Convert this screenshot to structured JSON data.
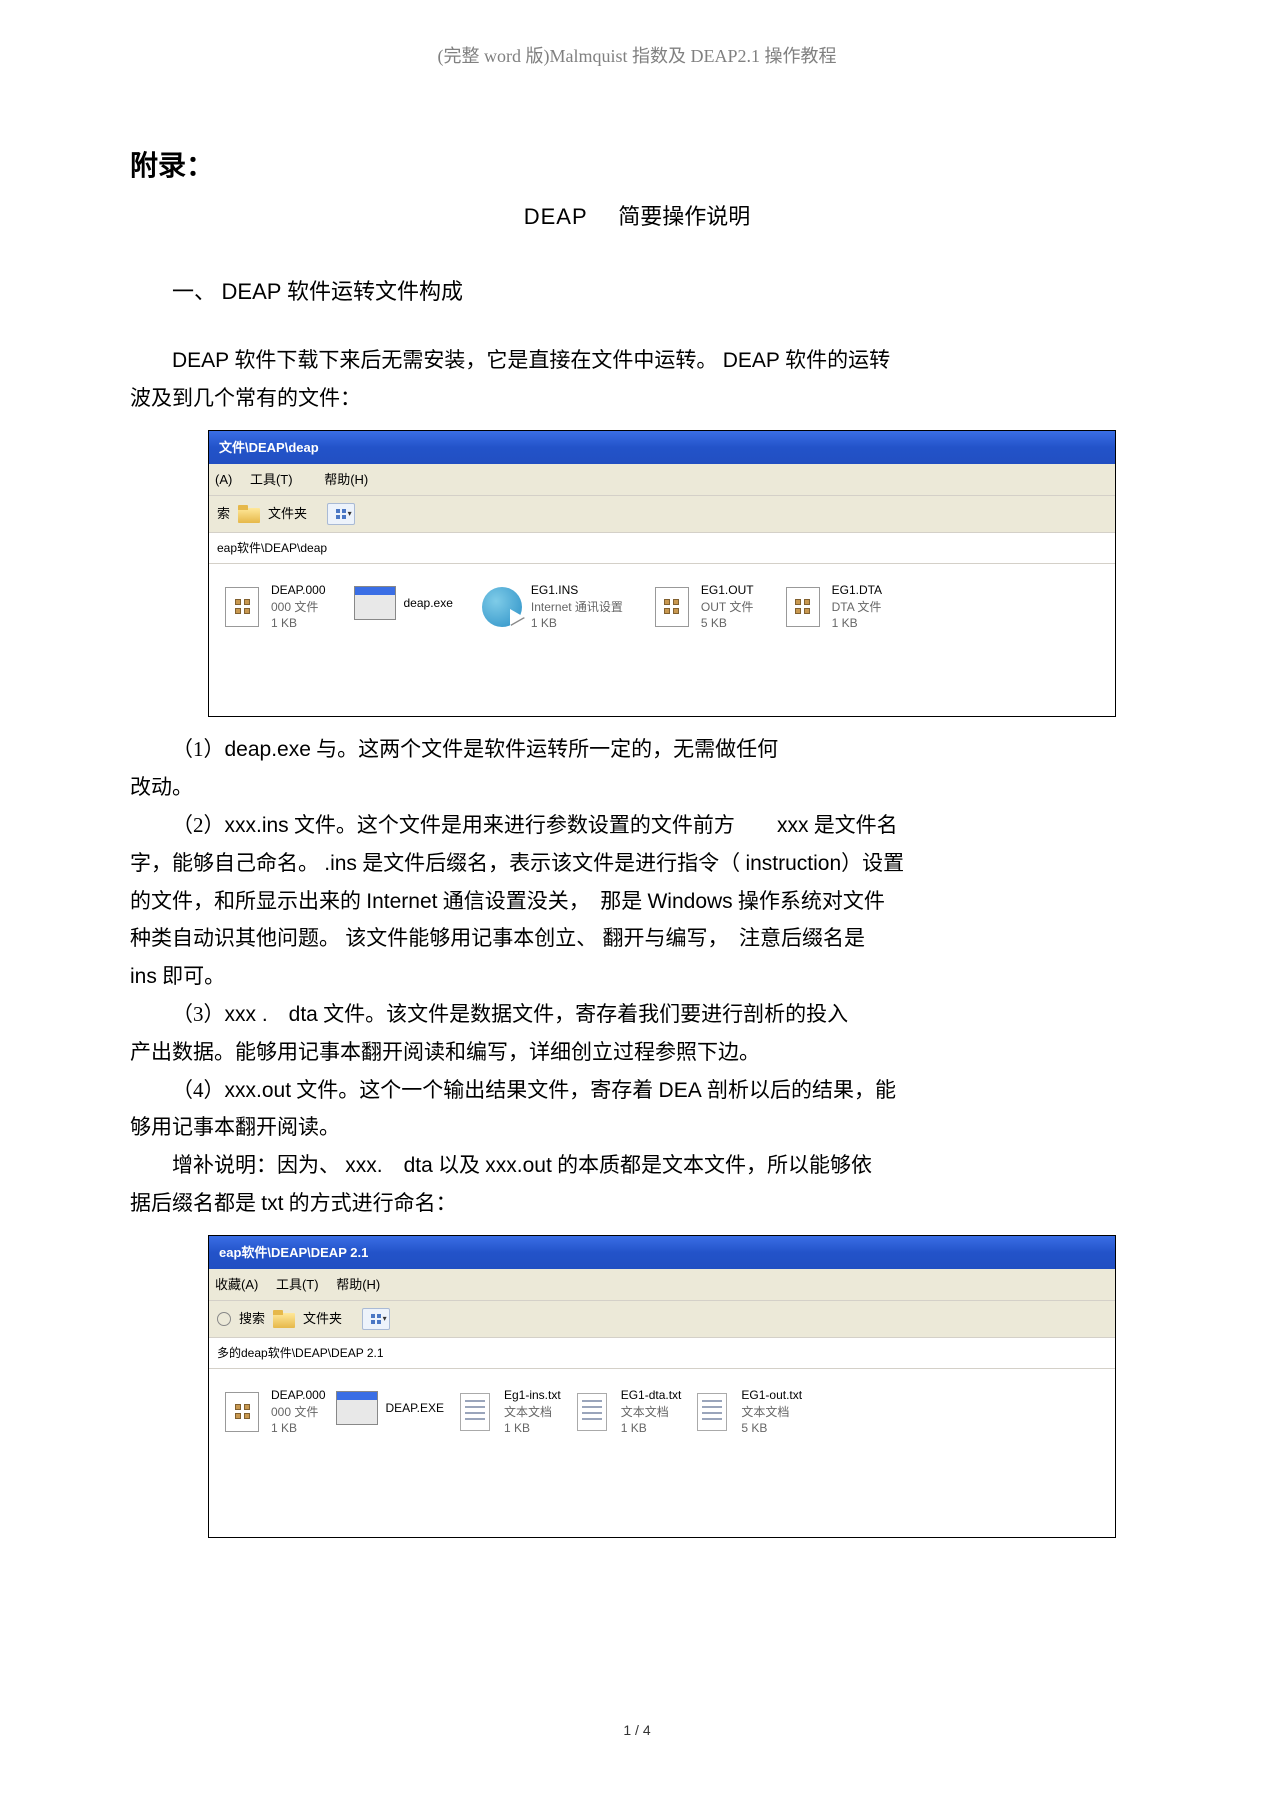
{
  "header": "(完整 word 版)Malmquist 指数及 DEAP2.1 操作教程",
  "appendix": "附录：",
  "title": {
    "left": "DEAP",
    "right": "简要操作说明"
  },
  "section1": {
    "num": "一、",
    "brand": "DEAP",
    "tail": " 软件运转文件构成"
  },
  "intro": {
    "a1": "DEAP",
    "a2": " 软件下载下来后无需安装，它是直接在文件中运转。 ",
    "a3": "DEAP",
    "a4": " 软件的运转",
    "b": "波及到几个常有的文件："
  },
  "win1": {
    "title": "文件\\DEAP\\deap",
    "menu": {
      "a": "(A)",
      "tools": "工具(T)",
      "help": "帮助(H)"
    },
    "toolbar": {
      "search": "索",
      "folders": "文件夹"
    },
    "address": "eap软件\\DEAP\\deap",
    "files": [
      {
        "name": "DEAP.000",
        "sub1": "000 文件",
        "sub2": "1 KB"
      },
      {
        "name": "deap.exe",
        "sub1": "",
        "sub2": ""
      },
      {
        "name": "EG1.INS",
        "sub1": "Internet 通讯设置",
        "sub2": "1 KB"
      },
      {
        "name": "EG1.OUT",
        "sub1": "OUT 文件",
        "sub2": "5 KB"
      },
      {
        "name": "EG1.DTA",
        "sub1": "DTA 文件",
        "sub2": "1 KB"
      }
    ]
  },
  "p1": {
    "a": "（1）",
    "b": "deap.exe",
    "c": " 与。这两个文件是软件运转所一定的，无需做任何"
  },
  "p1b": "改动。",
  "p2": {
    "a": "（2）",
    "b": "xxx.ins",
    "c": " 文件。这个文件是用来进行参数设置的文件前方　　",
    "d": "xxx",
    "e": " 是文件名"
  },
  "p2b": {
    "a": "字，能够自己命名。 ",
    "b": ".ins",
    "c": " 是文件后缀名，表示该文件是进行指令（ ",
    "d": "instruction",
    "e": "）设置"
  },
  "p2c": {
    "a": "的文件，和所显示出来的 ",
    "b": "Internet",
    "c": " 通信设置没关，　那是 ",
    "d": "Windows",
    "e": " 操作系统对文件"
  },
  "p2d": "种类自动识其他问题。 该文件能够用记事本创立、 翻开与编写，　注意后缀名是",
  "p2e": {
    "a": "ins",
    "b": " 即可。"
  },
  "p3": {
    "a": "（3）",
    "b": "xxx .　dta",
    "c": " 文件。该文件是数据文件，寄存着我们要进行剖析的投入"
  },
  "p3b": "产出数据。能够用记事本翻开阅读和编写，详细创立过程参照下边。",
  "p4": {
    "a": "（4）",
    "b": "xxx.out",
    "c": " 文件。这个一个输出结果文件，寄存着 ",
    "d": "DEA",
    "e": " 剖析以后的结果，能"
  },
  "p4b": "够用记事本翻开阅读。",
  "p5": {
    "a": "增补说明：因为、 ",
    "b": "xxx.　dta",
    "c": " 以及 ",
    "d": "xxx.out",
    "e": " 的本质都是文本文件，所以能够依"
  },
  "p5b": {
    "a": "据后缀名都是 ",
    "b": "txt",
    "c": " 的方式进行命名："
  },
  "win2": {
    "title": "eap软件\\DEAP\\DEAP 2.1",
    "menu": {
      "fav": "收藏(A)",
      "tools": "工具(T)",
      "help": "帮助(H)"
    },
    "toolbar": {
      "search": "搜索",
      "folders": "文件夹"
    },
    "address": "多的deap软件\\DEAP\\DEAP 2.1",
    "files": [
      {
        "name": "DEAP.000",
        "sub1": "000 文件",
        "sub2": "1 KB"
      },
      {
        "name": "DEAP.EXE",
        "sub1": "",
        "sub2": ""
      },
      {
        "name": "Eg1-ins.txt",
        "sub1": "文本文档",
        "sub2": "1 KB"
      },
      {
        "name": "EG1-dta.txt",
        "sub1": "文本文档",
        "sub2": "1 KB"
      },
      {
        "name": "EG1-out.txt",
        "sub1": "文本文档",
        "sub2": "5 KB"
      }
    ]
  },
  "footer": "1 / 4"
}
